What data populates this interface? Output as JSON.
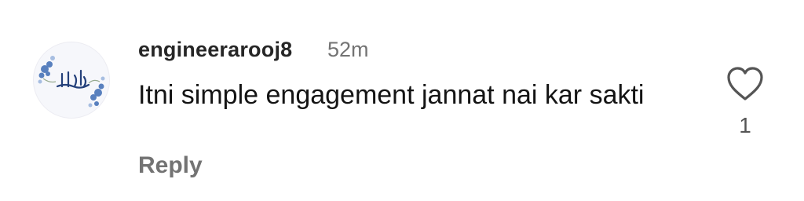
{
  "comment": {
    "avatar_icon": "floral-calligraphy-avatar",
    "username": "engineerarooj8",
    "timestamp": "52m",
    "text": "Itni simple engagement jannat nai kar sakti",
    "reply_label": "Reply",
    "like_icon": "heart-outline-icon",
    "like_count": "1"
  },
  "colors": {
    "username": "#262626",
    "secondary_text": "#737373",
    "body_text": "#141414",
    "avatar_accent": "#2f5fa8"
  }
}
